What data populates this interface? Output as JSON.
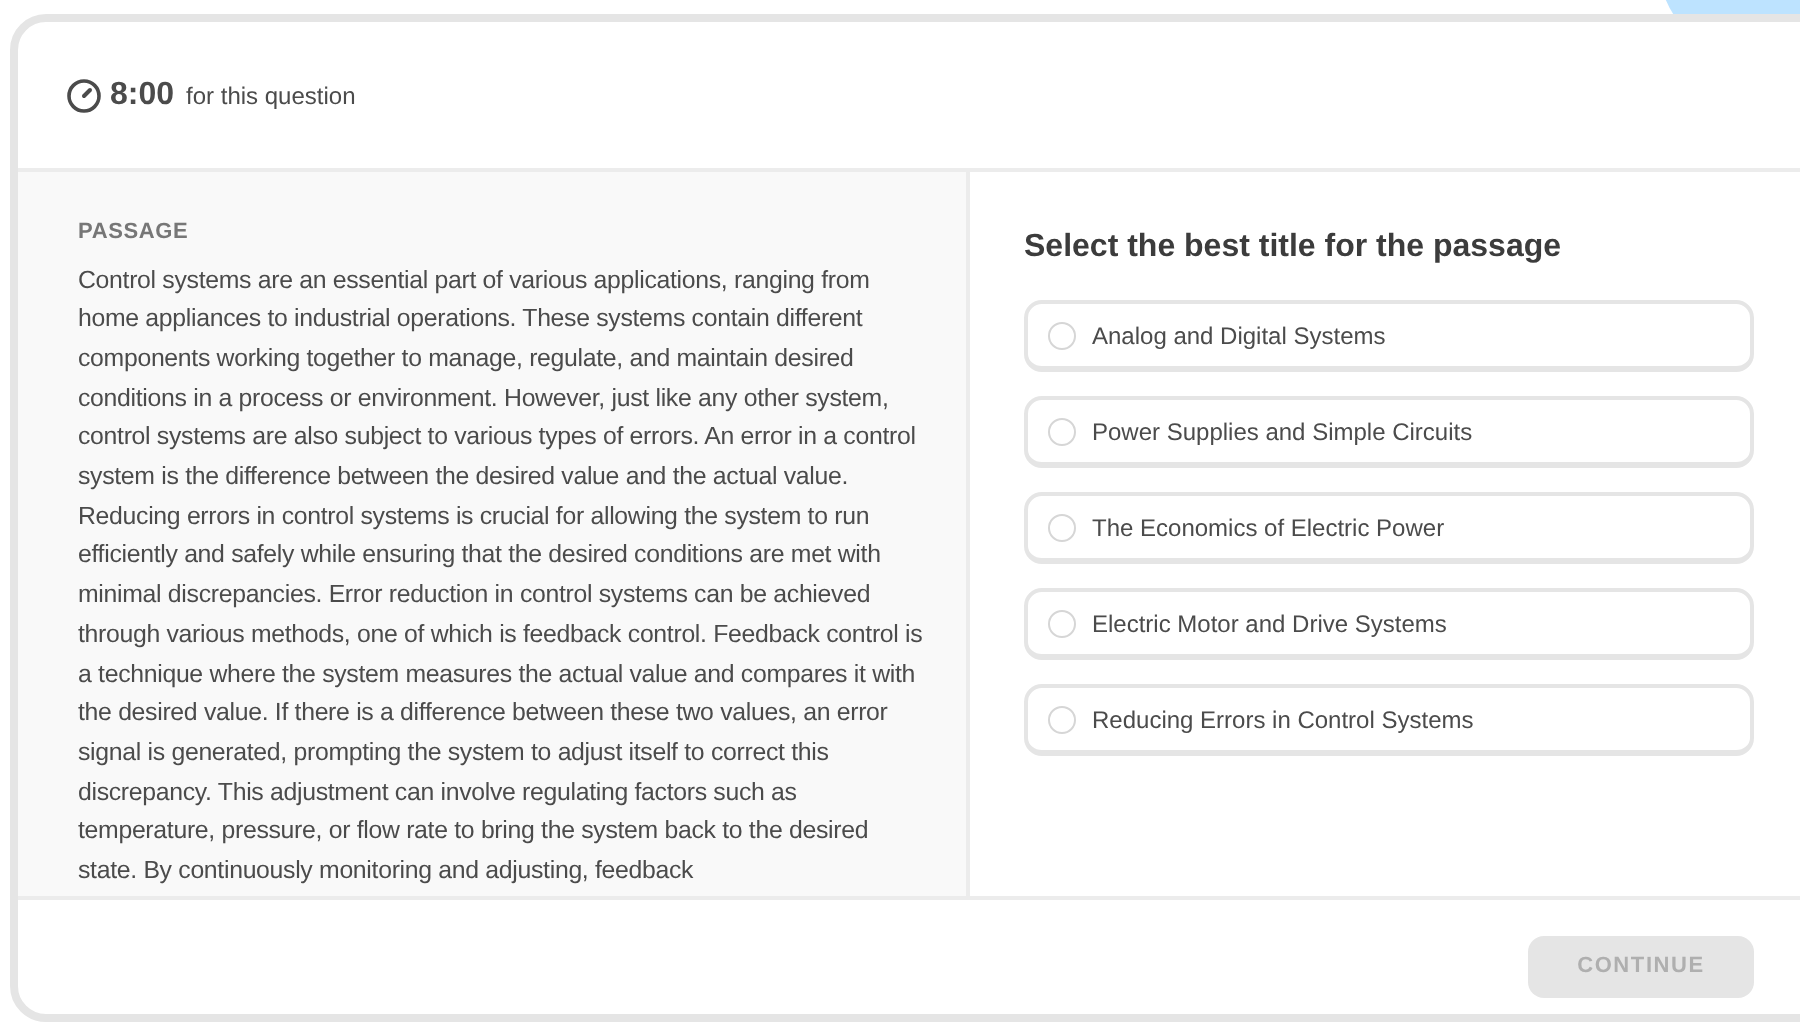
{
  "timer": {
    "time": "8:00",
    "label": "for this question"
  },
  "passage": {
    "heading": "PASSAGE",
    "text": "Control systems are an essential part of various applications, ranging from home appliances to industrial operations. These systems contain different components working together to manage, regulate, and maintain desired conditions in a process or environment. However, just like any other system, control systems are also subject to various types of errors. An error in a control system is the difference between the desired value and the actual value. Reducing errors in control systems is crucial for allowing the system to run efficiently and safely while ensuring that the desired conditions are met with minimal discrepancies. Error reduction in control systems can be achieved through various methods, one of which is feedback control. Feedback control is a technique where the system measures the actual value and compares it with the desired value. If there is a difference between these two values, an error signal is generated, prompting the system to adjust itself to correct this discrepancy. This adjustment can involve regulating factors such as temperature, pressure, or flow rate to bring the system back to the desired state. By continuously monitoring and adjusting, feedback"
  },
  "question": "Select the best title for the passage",
  "options": [
    {
      "label": "Analog and Digital Systems",
      "selected": false
    },
    {
      "label": "Power Supplies and Simple Circuits",
      "selected": false
    },
    {
      "label": "The Economics of Electric Power",
      "selected": false
    },
    {
      "label": "Electric Motor and Drive Systems",
      "selected": false
    },
    {
      "label": "Reducing Errors in Control Systems",
      "selected": false
    }
  ],
  "continue_button": {
    "label": "CONTINUE",
    "disabled": true
  }
}
